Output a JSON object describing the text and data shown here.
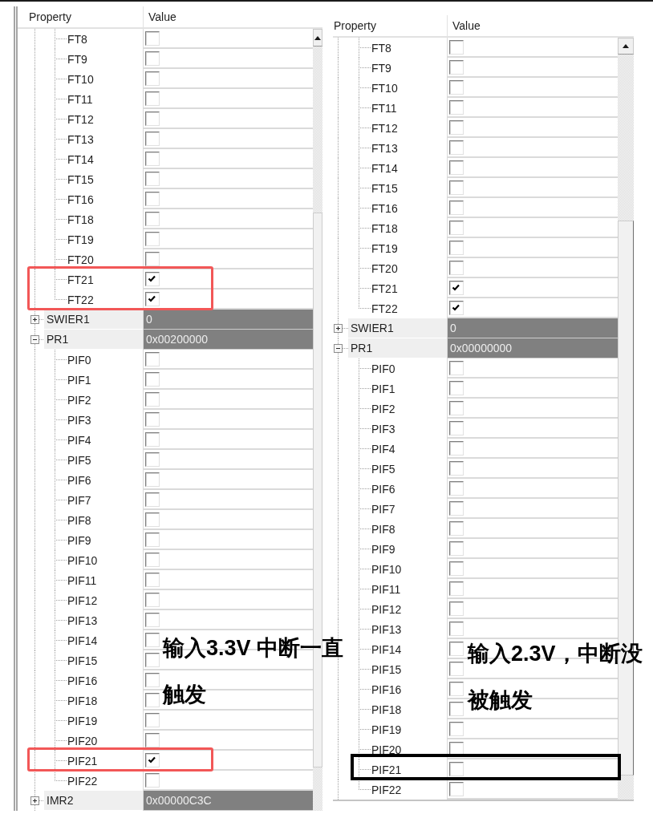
{
  "panels": [
    {
      "columns": [
        "Property",
        "Value"
      ],
      "rows": [
        {
          "children": [
            {
              "name": "FT8",
              "kind": "checkbox",
              "checked": false,
              "highlighted": false
            },
            {
              "name": "FT9",
              "kind": "checkbox",
              "checked": false,
              "highlighted": false
            },
            {
              "name": "FT10",
              "kind": "checkbox",
              "checked": false,
              "highlighted": false
            },
            {
              "name": "FT11",
              "kind": "checkbox",
              "checked": false,
              "highlighted": false
            },
            {
              "name": "FT12",
              "kind": "checkbox",
              "checked": false,
              "highlighted": false
            },
            {
              "name": "FT13",
              "kind": "checkbox",
              "checked": false,
              "highlighted": false
            },
            {
              "name": "FT14",
              "kind": "checkbox",
              "checked": false,
              "highlighted": false
            },
            {
              "name": "FT15",
              "kind": "checkbox",
              "checked": false,
              "highlighted": false
            },
            {
              "name": "FT16",
              "kind": "checkbox",
              "checked": false,
              "highlighted": false
            },
            {
              "name": "FT18",
              "kind": "checkbox",
              "checked": false,
              "highlighted": false
            },
            {
              "name": "FT19",
              "kind": "checkbox",
              "checked": false,
              "highlighted": false
            },
            {
              "name": "FT20",
              "kind": "checkbox",
              "checked": false,
              "highlighted": false
            },
            {
              "name": "FT21",
              "kind": "checkbox",
              "checked": true,
              "highlighted": true
            },
            {
              "name": "FT22",
              "kind": "checkbox",
              "checked": true,
              "highlighted": true
            }
          ]
        },
        {
          "name": "SWIER1",
          "kind": "register",
          "value": "0",
          "expanded": false,
          "highlighted": false
        },
        {
          "name": "PR1",
          "kind": "register",
          "value": "0x00200000",
          "expanded": true,
          "highlighted": false,
          "children": [
            {
              "name": "PIF0",
              "kind": "checkbox",
              "checked": false,
              "highlighted": false
            },
            {
              "name": "PIF1",
              "kind": "checkbox",
              "checked": false,
              "highlighted": false
            },
            {
              "name": "PIF2",
              "kind": "checkbox",
              "checked": false,
              "highlighted": false
            },
            {
              "name": "PIF3",
              "kind": "checkbox",
              "checked": false,
              "highlighted": false
            },
            {
              "name": "PIF4",
              "kind": "checkbox",
              "checked": false,
              "highlighted": false
            },
            {
              "name": "PIF5",
              "kind": "checkbox",
              "checked": false,
              "highlighted": false
            },
            {
              "name": "PIF6",
              "kind": "checkbox",
              "checked": false,
              "highlighted": false
            },
            {
              "name": "PIF7",
              "kind": "checkbox",
              "checked": false,
              "highlighted": false
            },
            {
              "name": "PIF8",
              "kind": "checkbox",
              "checked": false,
              "highlighted": false
            },
            {
              "name": "PIF9",
              "kind": "checkbox",
              "checked": false,
              "highlighted": false
            },
            {
              "name": "PIF10",
              "kind": "checkbox",
              "checked": false,
              "highlighted": false
            },
            {
              "name": "PIF11",
              "kind": "checkbox",
              "checked": false,
              "highlighted": false
            },
            {
              "name": "PIF12",
              "kind": "checkbox",
              "checked": false,
              "highlighted": false
            },
            {
              "name": "PIF13",
              "kind": "checkbox",
              "checked": false,
              "highlighted": false
            },
            {
              "name": "PIF14",
              "kind": "checkbox",
              "checked": false,
              "highlighted": false
            },
            {
              "name": "PIF15",
              "kind": "checkbox",
              "checked": false,
              "highlighted": false
            },
            {
              "name": "PIF16",
              "kind": "checkbox",
              "checked": false,
              "highlighted": false
            },
            {
              "name": "PIF18",
              "kind": "checkbox",
              "checked": false,
              "highlighted": false
            },
            {
              "name": "PIF19",
              "kind": "checkbox",
              "checked": false,
              "highlighted": false
            },
            {
              "name": "PIF20",
              "kind": "checkbox",
              "checked": false,
              "highlighted": false
            },
            {
              "name": "PIF21",
              "kind": "checkbox",
              "checked": true,
              "highlighted": true
            },
            {
              "name": "PIF22",
              "kind": "checkbox",
              "checked": false,
              "highlighted": false
            }
          ]
        },
        {
          "name": "IMR2",
          "kind": "register",
          "value": "0x00000C3C",
          "expanded": false,
          "highlighted": false
        }
      ],
      "highlight": {
        "color": "#f25757"
      },
      "annotation": [
        "输入3.3V 中断一直",
        "触发"
      ]
    },
    {
      "columns": [
        "Property",
        "Value"
      ],
      "rows": [
        {
          "children": [
            {
              "name": "FT8",
              "kind": "checkbox",
              "checked": false,
              "highlighted": false
            },
            {
              "name": "FT9",
              "kind": "checkbox",
              "checked": false,
              "highlighted": false
            },
            {
              "name": "FT10",
              "kind": "checkbox",
              "checked": false,
              "highlighted": false
            },
            {
              "name": "FT11",
              "kind": "checkbox",
              "checked": false,
              "highlighted": false
            },
            {
              "name": "FT12",
              "kind": "checkbox",
              "checked": false,
              "highlighted": false
            },
            {
              "name": "FT13",
              "kind": "checkbox",
              "checked": false,
              "highlighted": false
            },
            {
              "name": "FT14",
              "kind": "checkbox",
              "checked": false,
              "highlighted": false
            },
            {
              "name": "FT15",
              "kind": "checkbox",
              "checked": false,
              "highlighted": false
            },
            {
              "name": "FT16",
              "kind": "checkbox",
              "checked": false,
              "highlighted": false
            },
            {
              "name": "FT18",
              "kind": "checkbox",
              "checked": false,
              "highlighted": false
            },
            {
              "name": "FT19",
              "kind": "checkbox",
              "checked": false,
              "highlighted": false
            },
            {
              "name": "FT20",
              "kind": "checkbox",
              "checked": false,
              "highlighted": false
            },
            {
              "name": "FT21",
              "kind": "checkbox",
              "checked": true,
              "highlighted": false
            },
            {
              "name": "FT22",
              "kind": "checkbox",
              "checked": true,
              "highlighted": false
            }
          ]
        },
        {
          "name": "SWIER1",
          "kind": "register",
          "value": "0",
          "expanded": false,
          "highlighted": false
        },
        {
          "name": "PR1",
          "kind": "register",
          "value": "0x00000000",
          "expanded": true,
          "highlighted": false,
          "children": [
            {
              "name": "PIF0",
              "kind": "checkbox",
              "checked": false,
              "highlighted": false
            },
            {
              "name": "PIF1",
              "kind": "checkbox",
              "checked": false,
              "highlighted": false
            },
            {
              "name": "PIF2",
              "kind": "checkbox",
              "checked": false,
              "highlighted": false
            },
            {
              "name": "PIF3",
              "kind": "checkbox",
              "checked": false,
              "highlighted": false
            },
            {
              "name": "PIF4",
              "kind": "checkbox",
              "checked": false,
              "highlighted": false
            },
            {
              "name": "PIF5",
              "kind": "checkbox",
              "checked": false,
              "highlighted": false
            },
            {
              "name": "PIF6",
              "kind": "checkbox",
              "checked": false,
              "highlighted": false
            },
            {
              "name": "PIF7",
              "kind": "checkbox",
              "checked": false,
              "highlighted": false
            },
            {
              "name": "PIF8",
              "kind": "checkbox",
              "checked": false,
              "highlighted": false
            },
            {
              "name": "PIF9",
              "kind": "checkbox",
              "checked": false,
              "highlighted": false
            },
            {
              "name": "PIF10",
              "kind": "checkbox",
              "checked": false,
              "highlighted": false
            },
            {
              "name": "PIF11",
              "kind": "checkbox",
              "checked": false,
              "highlighted": false
            },
            {
              "name": "PIF12",
              "kind": "checkbox",
              "checked": false,
              "highlighted": false
            },
            {
              "name": "PIF13",
              "kind": "checkbox",
              "checked": false,
              "highlighted": false
            },
            {
              "name": "PIF14",
              "kind": "checkbox",
              "checked": false,
              "highlighted": false
            },
            {
              "name": "PIF15",
              "kind": "checkbox",
              "checked": false,
              "highlighted": false
            },
            {
              "name": "PIF16",
              "kind": "checkbox",
              "checked": false,
              "highlighted": false
            },
            {
              "name": "PIF18",
              "kind": "checkbox",
              "checked": false,
              "highlighted": false
            },
            {
              "name": "PIF19",
              "kind": "checkbox",
              "checked": false,
              "highlighted": false
            },
            {
              "name": "PIF20",
              "kind": "checkbox",
              "checked": false,
              "highlighted": false
            },
            {
              "name": "PIF21",
              "kind": "checkbox",
              "checked": false,
              "highlighted": true
            },
            {
              "name": "PIF22",
              "kind": "checkbox",
              "checked": false,
              "highlighted": false
            }
          ]
        }
      ],
      "highlight": {
        "color": "#000000"
      },
      "annotation": [
        "输入2.3V，中断没",
        "被触发"
      ]
    }
  ]
}
